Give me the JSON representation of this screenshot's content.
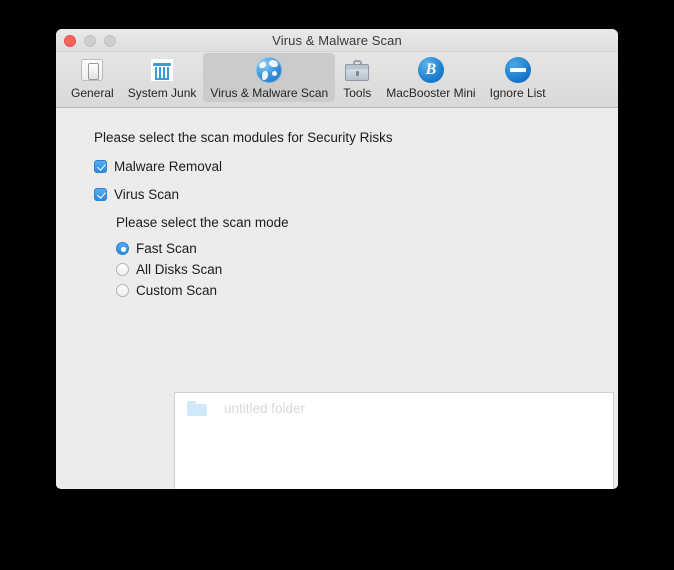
{
  "window": {
    "title": "Virus & Malware Scan",
    "traffic_lights": [
      {
        "name": "close",
        "color": "#f9635a"
      },
      {
        "name": "minimize",
        "color": "#cfcfcf"
      },
      {
        "name": "zoom",
        "color": "#cfcfcf"
      }
    ]
  },
  "toolbar": {
    "items": [
      {
        "label": "General",
        "icon": "toggle-switch-icon",
        "selected": false
      },
      {
        "label": "System Junk",
        "icon": "trash-bin-icon",
        "selected": false
      },
      {
        "label": "Virus & Malware Scan",
        "icon": "globe-icon",
        "selected": true
      },
      {
        "label": "Tools",
        "icon": "toolbox-icon",
        "selected": false
      },
      {
        "label": "MacBooster Mini",
        "icon": "b-circle-icon",
        "selected": false
      },
      {
        "label": "Ignore List",
        "icon": "no-entry-icon",
        "selected": false
      }
    ]
  },
  "main": {
    "modules_heading": "Please select the scan modules for Security Risks",
    "modules": [
      {
        "label": "Malware Removal",
        "checked": true
      },
      {
        "label": "Virus Scan",
        "checked": true
      }
    ],
    "scan_mode_heading": "Please select the scan mode",
    "scan_modes": [
      {
        "label": "Fast Scan",
        "selected": true
      },
      {
        "label": "All Disks Scan",
        "selected": false
      },
      {
        "label": "Custom Scan",
        "selected": false
      }
    ],
    "folder_list": [
      {
        "name": "untitled folder",
        "icon": "folder-icon",
        "disabled": true
      }
    ],
    "list_buttons": [
      {
        "label": "+",
        "name": "add-folder-button",
        "enabled": false
      },
      {
        "label": "−",
        "name": "remove-folder-button",
        "enabled": false
      }
    ]
  },
  "colors": {
    "accent": "#2a8ae0",
    "window_bg": "#ececec",
    "toolbar_bg": "#dedede",
    "selected_tab_bg": "#cbcbcb",
    "list_bg": "#ffffff",
    "disabled_text": "#d8d8d8"
  }
}
